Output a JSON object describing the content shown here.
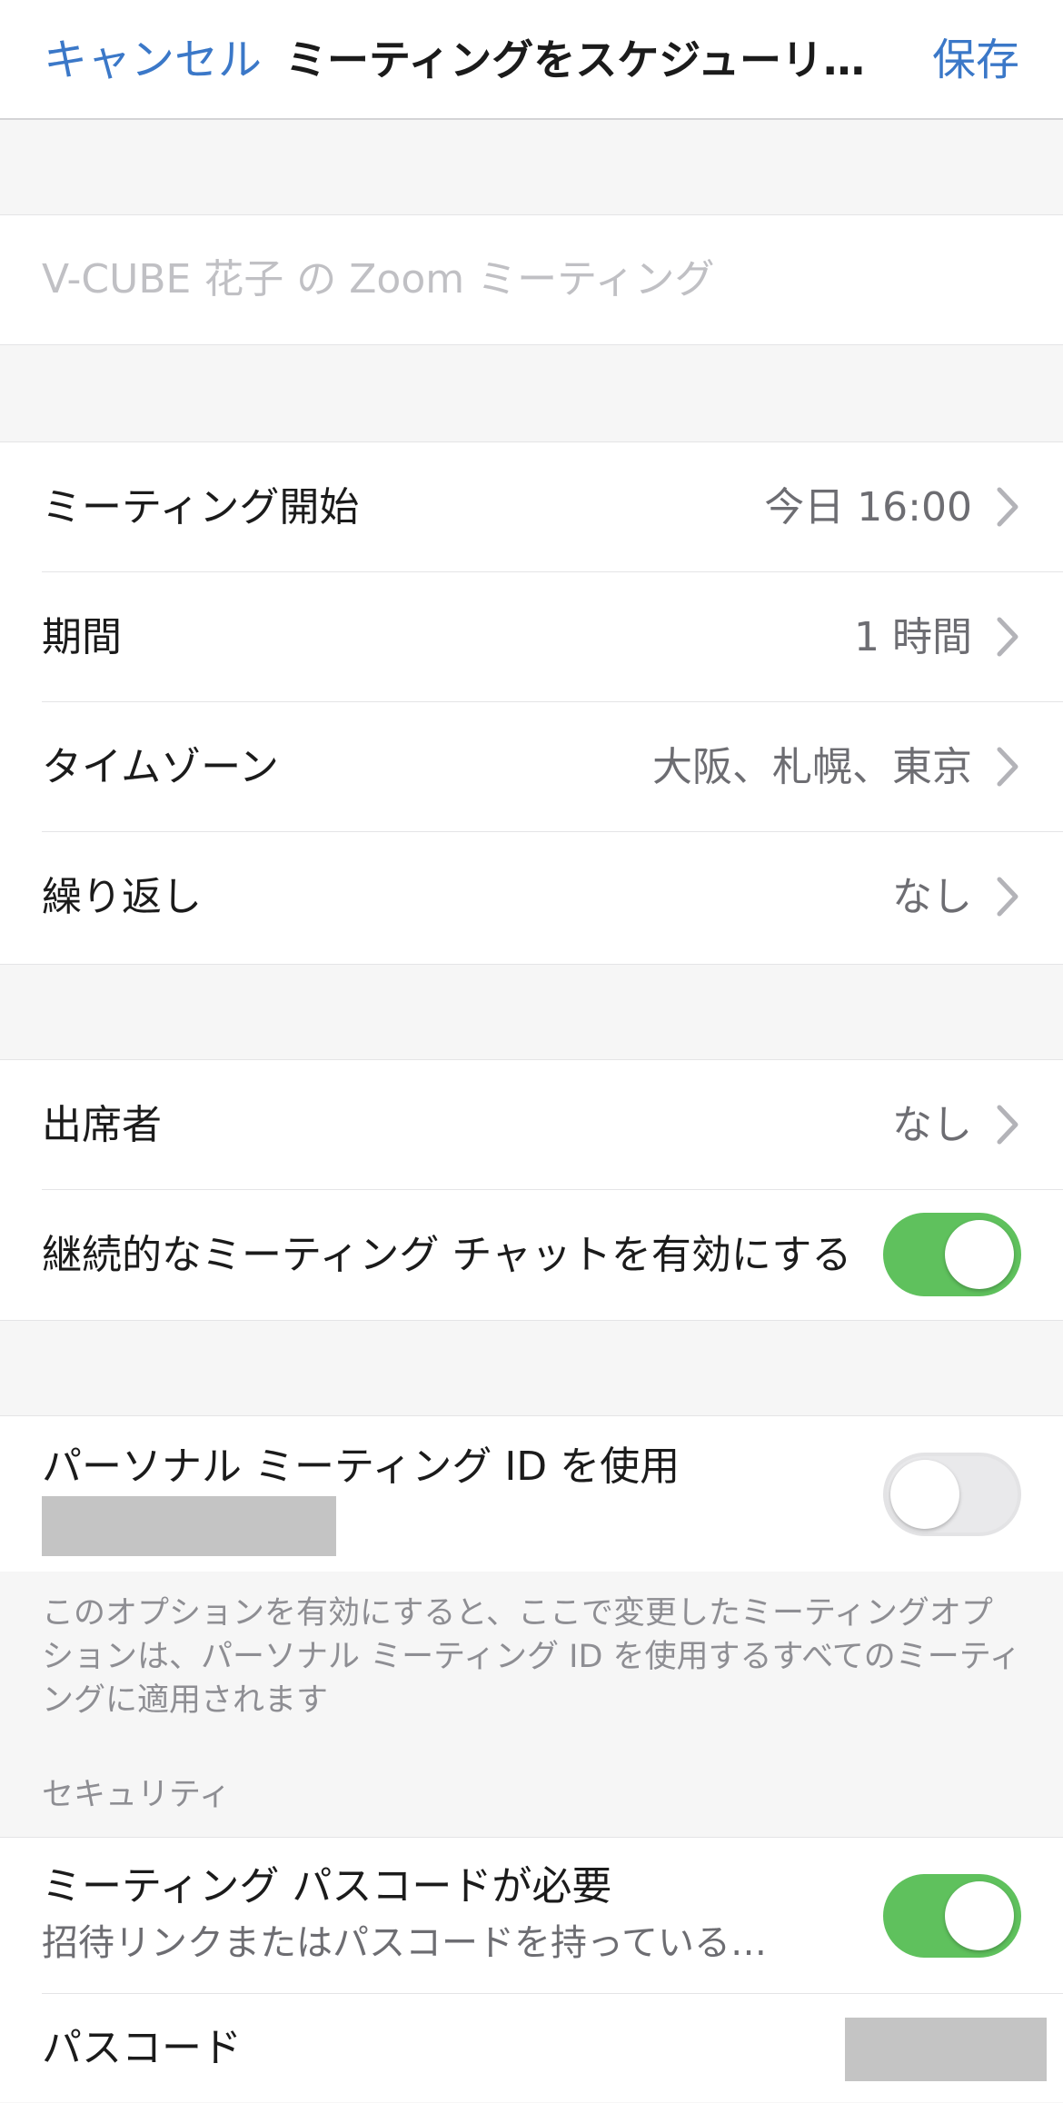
{
  "nav": {
    "cancel": "キャンセル",
    "title": "ミーティングをスケジューリ…",
    "save": "保存"
  },
  "topic": {
    "placeholder": "V-CUBE 花子 の Zoom ミーティング"
  },
  "schedule": {
    "start_label": "ミーティング開始",
    "start_value": "今日 16:00",
    "duration_label": "期間",
    "duration_value": "1 時間",
    "timezone_label": "タイムゾーン",
    "timezone_value": "大阪、札幌、東京",
    "repeat_label": "繰り返し",
    "repeat_value": "なし"
  },
  "attendees": {
    "label": "出席者",
    "value": "なし",
    "chat_label": "継続的なミーティング チャットを有効にする",
    "chat_enabled": true
  },
  "pmi": {
    "label": "パーソナル ミーティング ID を使用",
    "enabled": false,
    "note": "このオプションを有効にすると、ここで変更したミーティングオプションは、パーソナル ミーティング ID を使用するすべてのミーティングに適用されます"
  },
  "security": {
    "header": "セキュリティ",
    "passcode_required_label": "ミーティング パスコードが必要",
    "passcode_required_sub": "招待リンクまたはパスコードを持っている…",
    "passcode_required_enabled": true,
    "passcode_label": "パスコード"
  },
  "colors": {
    "accent": "#3b78c8",
    "toggle_on": "#5fc15d",
    "toggle_off": "#e9e9eb",
    "background": "#f6f6f6"
  },
  "icons": {
    "chevron": "chevron-right-icon"
  }
}
